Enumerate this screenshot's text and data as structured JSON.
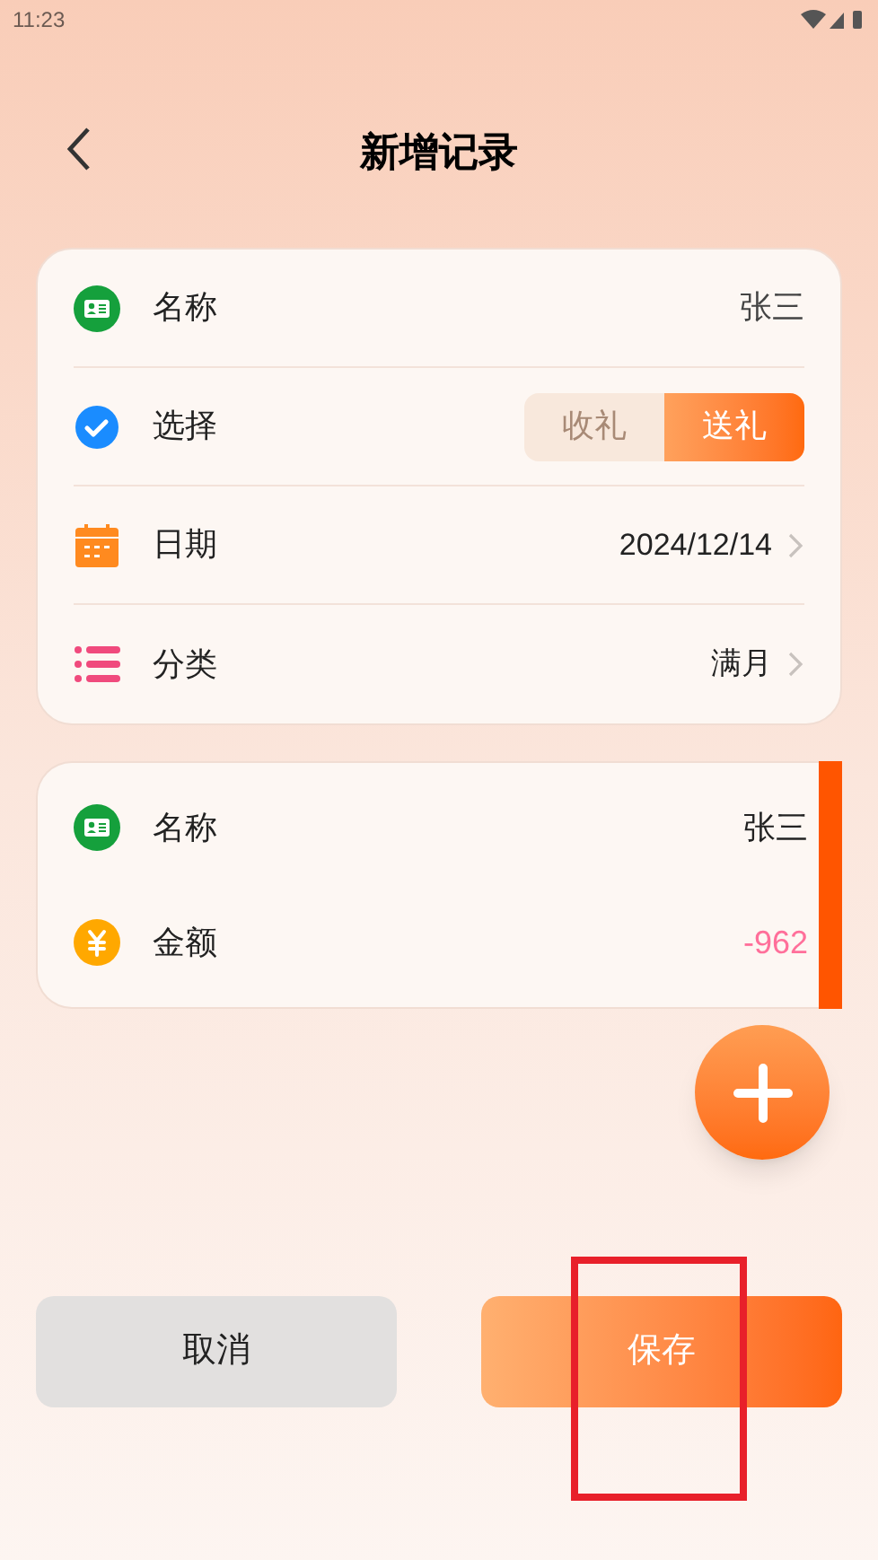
{
  "status_bar": {
    "time": "11:23"
  },
  "header": {
    "title": "新增记录"
  },
  "form": [
    {
      "kind": "text",
      "label": "名称",
      "value": "张三"
    },
    {
      "kind": "segmented",
      "label": "选择",
      "options": [
        {
          "label": "收礼",
          "selected": false
        },
        {
          "label": "送礼",
          "selected": true
        }
      ]
    },
    {
      "kind": "link",
      "label": "日期",
      "value": "2024/12/14"
    },
    {
      "kind": "link",
      "label": "分类",
      "value": "满月"
    }
  ],
  "entries": [
    {
      "label": "名称",
      "value": "张三",
      "negative": false
    },
    {
      "label": "金额",
      "value": "-962",
      "negative": true
    }
  ],
  "buttons": {
    "cancel": "取消",
    "save": "保存"
  }
}
